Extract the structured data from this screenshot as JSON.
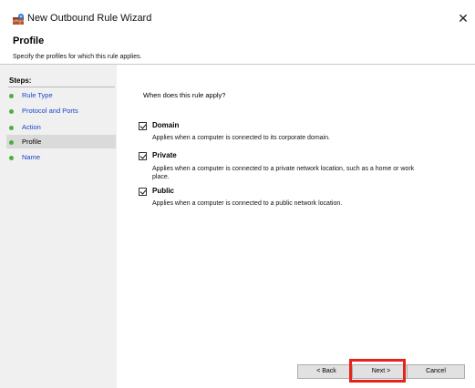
{
  "window": {
    "title": "New Outbound Rule Wizard",
    "close_glyph": "✕"
  },
  "header": {
    "title": "Profile",
    "subtitle": "Specify the profiles for which this rule applies."
  },
  "sidebar": {
    "steps_title": "Steps:",
    "items": [
      {
        "label": "Rule Type",
        "current": false
      },
      {
        "label": "Protocol and Ports",
        "current": false
      },
      {
        "label": "Action",
        "current": false
      },
      {
        "label": "Profile",
        "current": true
      },
      {
        "label": "Name",
        "current": false
      }
    ]
  },
  "main": {
    "question": "When does this rule apply?",
    "options": [
      {
        "label": "Domain",
        "checked": true,
        "description": "Applies when a computer is connected to its corporate domain."
      },
      {
        "label": "Private",
        "checked": true,
        "description": "Applies when a computer is connected to a private network location, such as a home or work place."
      },
      {
        "label": "Public",
        "checked": true,
        "description": "Applies when a computer is connected to a public network location."
      }
    ]
  },
  "buttons": {
    "back": "< Back",
    "next": "Next >",
    "cancel": "Cancel"
  },
  "colors": {
    "link": "#1a46c8",
    "step_dot": "#4caf3e",
    "highlight": "#e5231b",
    "sidebar_bg": "#f0f0f0"
  }
}
